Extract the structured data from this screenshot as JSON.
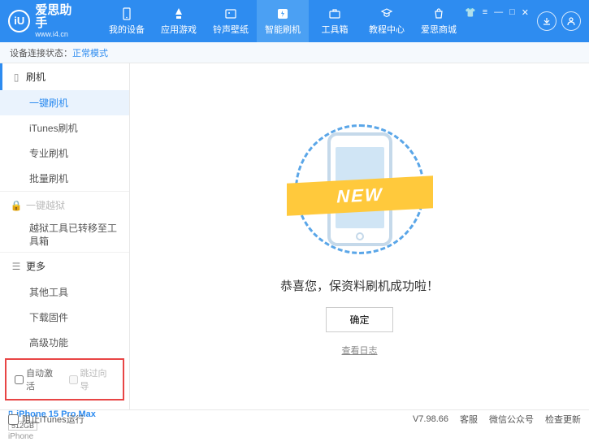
{
  "header": {
    "logo_text": "iU",
    "title": "爱思助手",
    "url": "www.i4.cn",
    "nav": [
      {
        "label": "我的设备"
      },
      {
        "label": "应用游戏"
      },
      {
        "label": "铃声壁纸"
      },
      {
        "label": "智能刷机"
      },
      {
        "label": "工具箱"
      },
      {
        "label": "教程中心"
      },
      {
        "label": "爱思商城"
      }
    ]
  },
  "status": {
    "label": "设备连接状态：",
    "value": "正常模式"
  },
  "sidebar": {
    "group1": {
      "header": "刷机",
      "items": [
        "一键刷机",
        "iTunes刷机",
        "专业刷机",
        "批量刷机"
      ]
    },
    "group2": {
      "header": "一键越狱",
      "items": [
        "越狱工具已转移至工具箱"
      ]
    },
    "group3": {
      "header": "更多",
      "items": [
        "其他工具",
        "下载固件",
        "高级功能"
      ]
    },
    "checkboxes": {
      "cb1": "自动激活",
      "cb2": "跳过向导"
    },
    "device": {
      "name": "iPhone 15 Pro Max",
      "storage": "512GB",
      "type": "iPhone"
    }
  },
  "main": {
    "ribbon": "NEW",
    "success": "恭喜您，保资料刷机成功啦！",
    "confirm": "确定",
    "log_link": "查看日志"
  },
  "footer": {
    "block_itunes": "阻止iTunes运行",
    "version": "V7.98.66",
    "items": [
      "客服",
      "微信公众号",
      "检查更新"
    ]
  }
}
